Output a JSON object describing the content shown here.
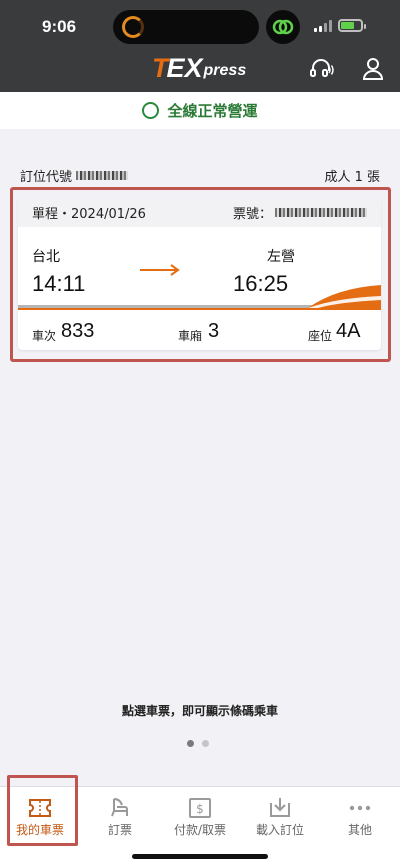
{
  "status_bar": {
    "time": "9:06"
  },
  "header": {
    "logo_t": "T",
    "logo_ex": "EX",
    "logo_press": "press",
    "icons": [
      "headset-icon",
      "user-icon"
    ],
    "accent": "#e46c12"
  },
  "service": {
    "status_text": "全線正常營運",
    "color": "#2b7a35"
  },
  "booking": {
    "pnr_label": "訂位代號",
    "passenger_text": "成人 1 張"
  },
  "ticket": {
    "trip_text": "單程・2024/01/26",
    "ticket_no_label": "票號：",
    "from_station": "台北",
    "depart_time": "14:11",
    "to_station": "左營",
    "arrive_time": "16:25",
    "train_no_label": "車次",
    "train_no": "833",
    "car_label": "車廂",
    "car_no": "3",
    "seat_label": "座位",
    "seat_no": "4A"
  },
  "hint_text": "點選車票，即可顯示條碼乘車",
  "pager": {
    "count": 2,
    "active": 1
  },
  "tabs": [
    {
      "label": "我的車票",
      "icon": "ticket-icon",
      "active": true
    },
    {
      "label": "訂票",
      "icon": "seat-icon",
      "active": false
    },
    {
      "label": "付款/取票",
      "icon": "payment-icon",
      "active": false
    },
    {
      "label": "載入訂位",
      "icon": "download-icon",
      "active": false
    },
    {
      "label": "其他",
      "icon": "more-icon",
      "active": false
    }
  ]
}
